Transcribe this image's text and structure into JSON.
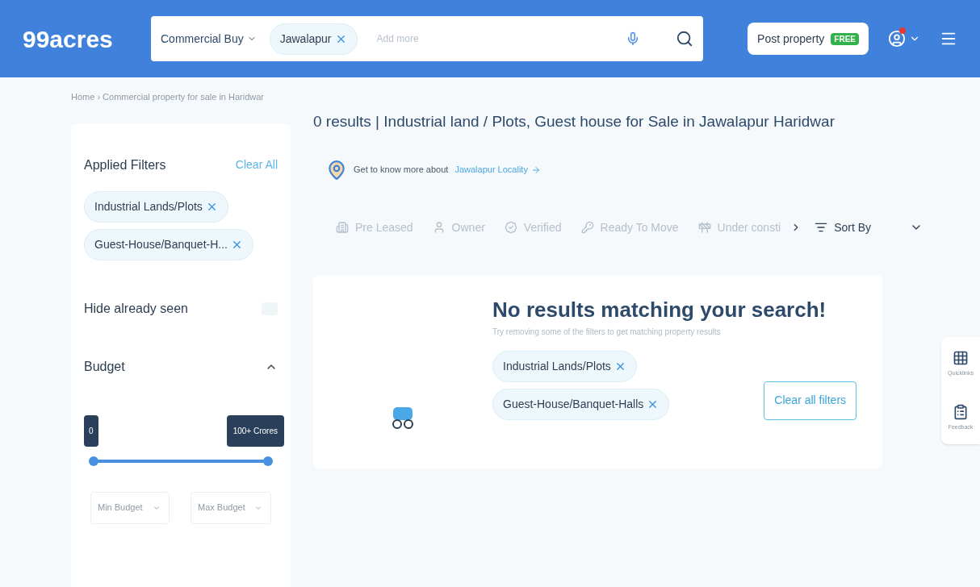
{
  "header": {
    "logo": "99acres",
    "search": {
      "category": "Commercial Buy",
      "chip": "Jawalapur",
      "placeholder": "Add more"
    },
    "post_button": "Post property",
    "post_badge": "FREE",
    "has_notification": true
  },
  "breadcrumb": "Home › Commercial property for sale in Haridwar",
  "sidebar": {
    "title": "Applied Filters",
    "clear": "Clear All",
    "chips": [
      "Industrial Lands/Plots",
      "Guest-House/Banquet-H..."
    ],
    "hide_seen": {
      "label": "Hide already seen",
      "on": false
    },
    "budget": {
      "title": "Budget",
      "expanded": true,
      "min_label": "0",
      "max_label": "100+ Crores",
      "min": {
        "level": 0
      },
      "max": {
        "level": 1
      },
      "min_placeholder": "Min Budget",
      "max_placeholder": "Max Budget"
    }
  },
  "results_title": "0 results | Industrial land / Plots, Guest house for Sale in Jawalapur Haridwar",
  "locality": {
    "text": "Get to know more about",
    "link": "Jawalapur Locality"
  },
  "quick_filters": [
    {
      "label": "Pre Leased",
      "kind": "building"
    },
    {
      "label": "Owner",
      "kind": "person"
    },
    {
      "label": "Verified",
      "kind": "check"
    },
    {
      "label": "Ready To Move",
      "kind": "key"
    },
    {
      "label": "Under consti",
      "kind": "construction"
    }
  ],
  "sort": "Sort By",
  "empty": {
    "title": "No results matching your search!",
    "subtitle": "Try removing some of the filters to get matching property results",
    "chips": [
      "Industrial Lands/Plots",
      "Guest-House/Banquet-Halls"
    ],
    "clear_button": "Clear all filters"
  },
  "side_tools": [
    {
      "label": "Quicklinks",
      "kind": "grid"
    },
    {
      "label": "Feedback",
      "kind": "clipboard"
    }
  ]
}
